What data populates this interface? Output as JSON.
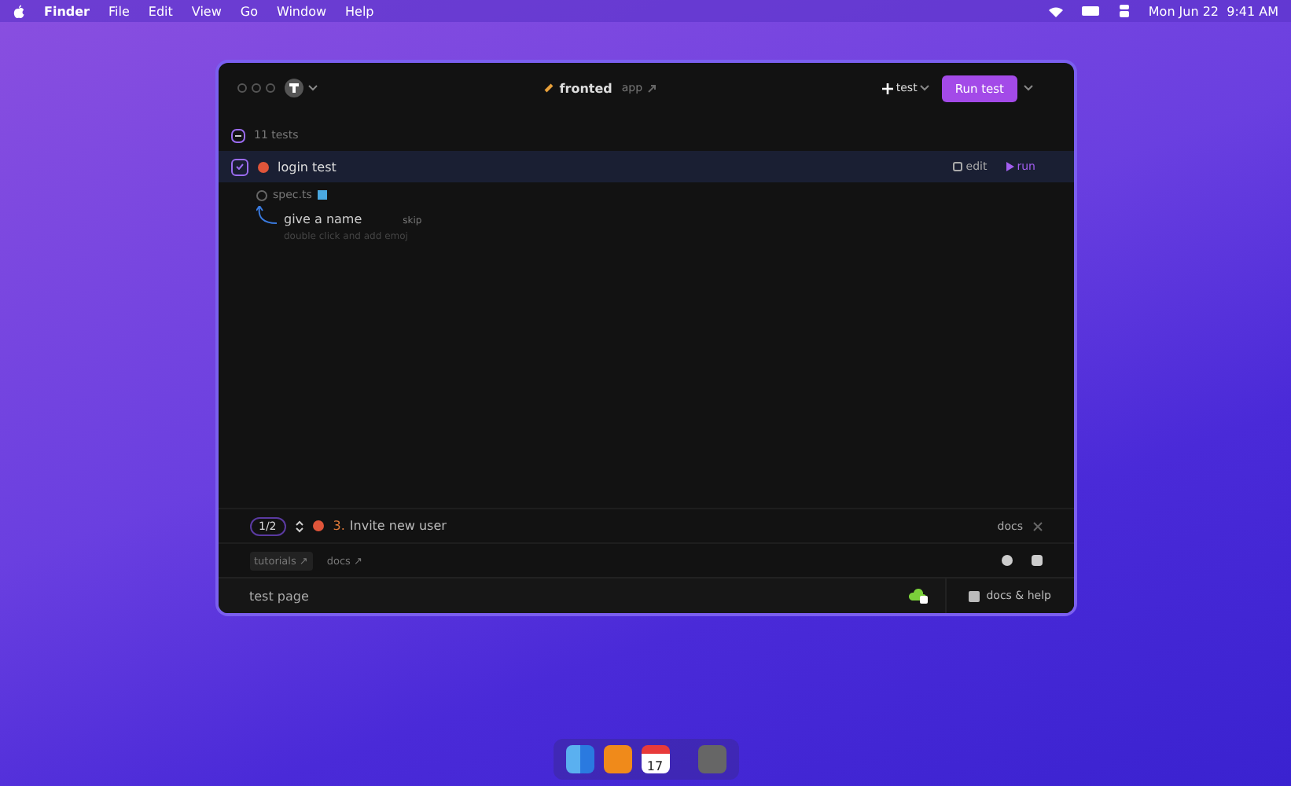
{
  "menu_bar": {
    "items": [
      {
        "label": "Finder",
        "bold": true
      },
      {
        "label": "File",
        "bold": false
      },
      {
        "label": "Edit",
        "bold": false
      },
      {
        "label": "View",
        "bold": false
      },
      {
        "label": "Go",
        "bold": false
      },
      {
        "label": "Window",
        "bold": false
      },
      {
        "label": "Help",
        "bold": false
      }
    ],
    "clock": "Mon Jun 22  9:41 AM"
  },
  "window": {
    "project": "fronted",
    "subtitle": "app",
    "new_test": "test",
    "run_button": "Run test"
  },
  "tests": {
    "count": "11 tests",
    "items": [
      {
        "name": "login test",
        "selected": true,
        "edit": "edit",
        "run": "run"
      }
    ]
  },
  "spec": {
    "file": "spec.ts",
    "name_hint": "give a name",
    "skip": "skip",
    "hint": "double click and add emoj"
  },
  "step_bar": {
    "counter": "1/2",
    "step_number": "3.",
    "step": "Invite new user",
    "docs": "docs"
  },
  "links": [
    {
      "label": "tutorials ↗",
      "boxed": true
    },
    {
      "label": "docs ↗",
      "boxed": false
    }
  ],
  "footer": {
    "page": "test page",
    "help": "docs & help"
  },
  "dock": {
    "calendar_day": "17"
  }
}
